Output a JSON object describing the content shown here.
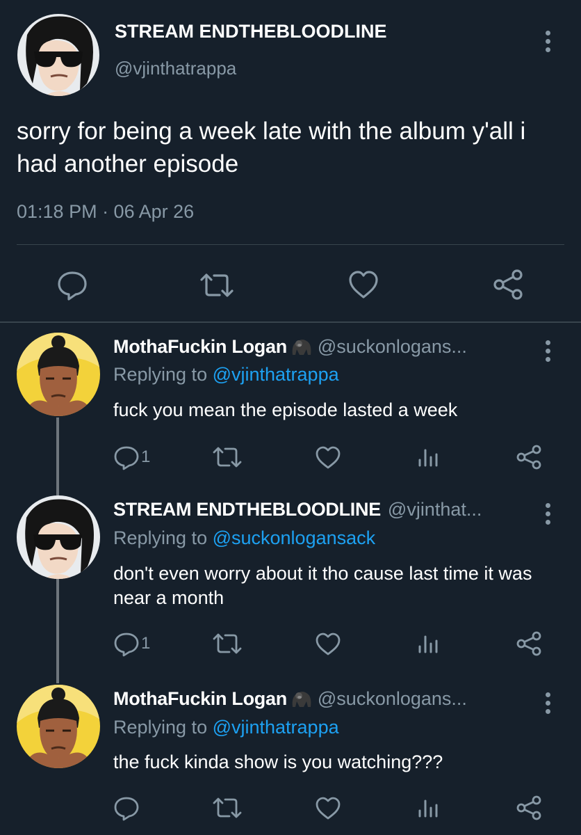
{
  "main_tweet": {
    "author_name": "STREAM ENDTHEBLOODLINE",
    "author_handle": "@vjinthatrappa",
    "text": "sorry for being a week late with the album y'all i had another episode",
    "timestamp": "01:18 PM · 06 Apr 26",
    "actions": [
      "reply-icon",
      "retweet-icon",
      "like-icon",
      "share-icon"
    ]
  },
  "replies": [
    {
      "author_name": "MothaFuckin Logan",
      "emoji": "gorilla",
      "author_handle": "@suckonlogans...",
      "replying_prefix": "Replying to ",
      "replying_to": "@vjinthatrappa",
      "text": "fuck you mean the episode lasted a week",
      "reply_count": "1"
    },
    {
      "author_name": "STREAM ENDTHEBLOODLINE",
      "author_handle": "@vjinthat...",
      "replying_prefix": "Replying to ",
      "replying_to": "@suckonlogansack",
      "text": "don't even worry about it tho cause last time it was near a month",
      "reply_count": "1"
    },
    {
      "author_name": "MothaFuckin Logan",
      "emoji": "gorilla",
      "author_handle": "@suckonlogans...",
      "replying_prefix": "Replying to ",
      "replying_to": "@vjinthatrappa",
      "text": "the fuck kinda show is you watching???",
      "reply_count": ""
    }
  ],
  "colors": {
    "background": "#16202b",
    "secondary_text": "#8899a6",
    "link": "#1da1f2",
    "divider": "#38444d"
  }
}
